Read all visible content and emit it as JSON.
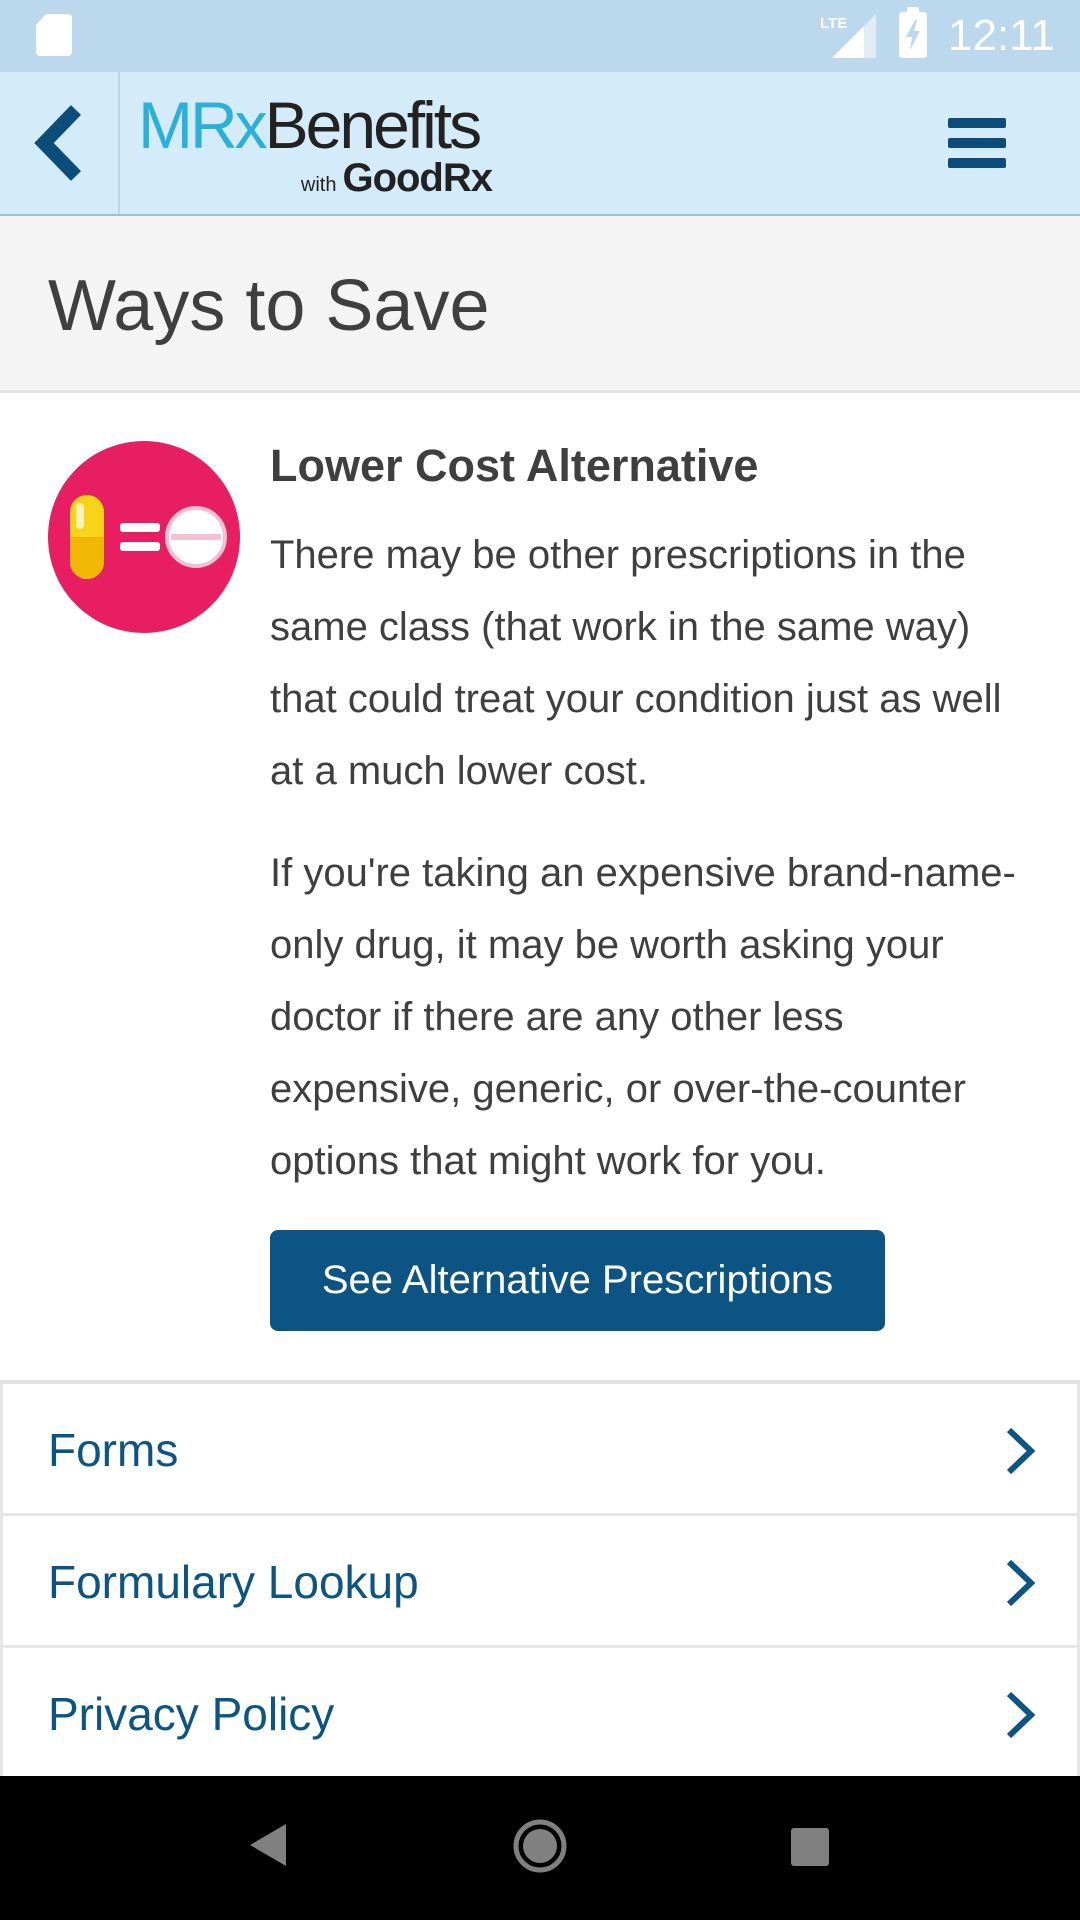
{
  "status_bar": {
    "time": "12:11",
    "network": "LTE",
    "icons": [
      "sd-card-icon",
      "lte-signal-icon",
      "battery-charging-icon"
    ]
  },
  "header": {
    "back_icon": "chevron-left-icon",
    "logo": {
      "part1": "MRx",
      "part2": "Benefits",
      "with": "with",
      "brand": "GoodRx"
    },
    "menu_icon": "hamburger-menu-icon"
  },
  "page": {
    "title": "Ways to Save"
  },
  "card": {
    "icon": "pill-equals-tablet-icon",
    "title": "Lower Cost Alternative",
    "paragraph1": "There may be other prescriptions in the same class (that work in the same way) that could treat your condition just as well at a much lower cost.",
    "paragraph2": "If you're taking an expensive brand-name-only drug, it may be worth asking your doctor if there are any other less expensive, generic, or over-the-counter options that might work for you.",
    "button_label": "See Alternative Prescriptions"
  },
  "links": [
    {
      "label": "Forms",
      "icon": "chevron-right-icon"
    },
    {
      "label": "Formulary Lookup",
      "icon": "chevron-right-icon"
    },
    {
      "label": "Privacy Policy",
      "icon": "chevron-right-icon"
    }
  ],
  "nav_bar": {
    "icons": [
      "nav-back-icon",
      "nav-home-icon",
      "nav-recents-icon"
    ]
  },
  "colors": {
    "status_bar": "#bcd8ec",
    "header": "#d4ebfa",
    "brand_blue": "#0b5483",
    "logo_cyan": "#2ab0d9",
    "pill_icon_bg": "#e81e63",
    "text": "#3f3f3f",
    "title_band": "#f4f4f4"
  }
}
